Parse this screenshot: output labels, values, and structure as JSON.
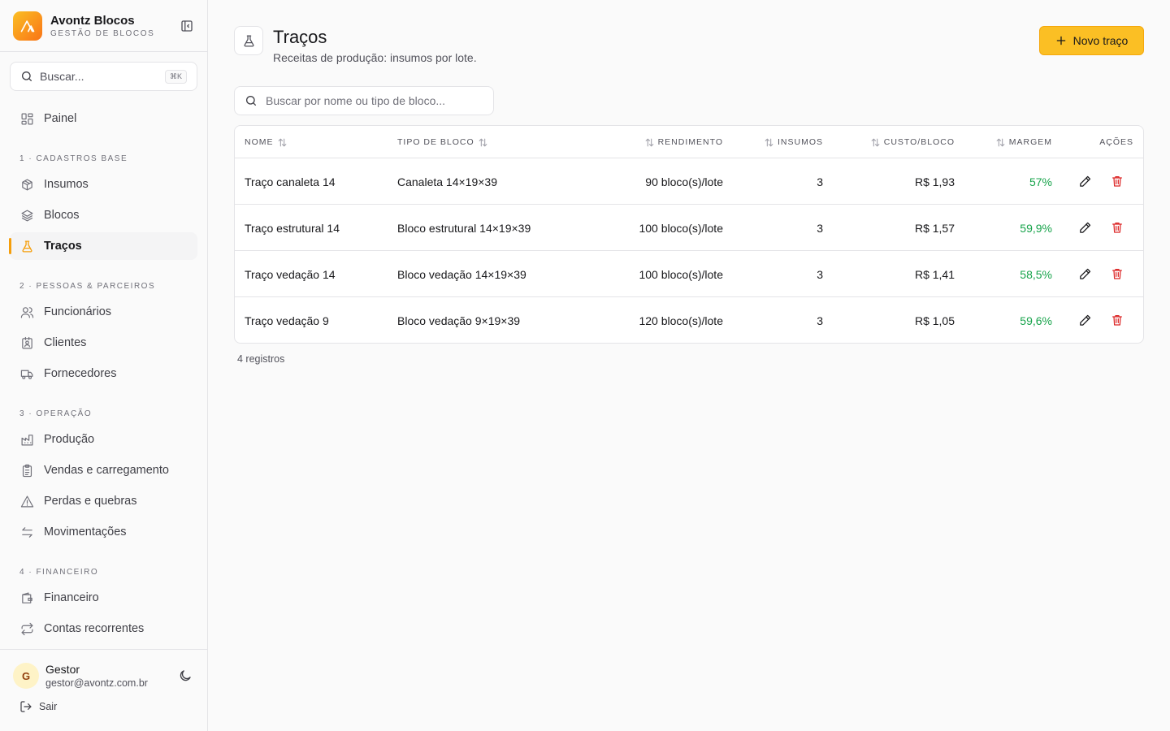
{
  "brand": {
    "name": "Avontz Blocos",
    "subtitle": "GESTÃO DE BLOCOS"
  },
  "sidebar": {
    "search_placeholder": "Buscar...",
    "search_shortcut": "⌘K",
    "home": {
      "label": "Painel",
      "icon": "dashboard-icon"
    },
    "sections": [
      {
        "label": "1 · CADASTROS BASE",
        "items": [
          {
            "label": "Insumos",
            "icon": "package-icon"
          },
          {
            "label": "Blocos",
            "icon": "layers-icon"
          },
          {
            "label": "Traços",
            "icon": "flask-icon",
            "active": true
          }
        ]
      },
      {
        "label": "2 · PESSOAS & PARCEIROS",
        "items": [
          {
            "label": "Funcionários",
            "icon": "users-icon"
          },
          {
            "label": "Clientes",
            "icon": "contact-icon"
          },
          {
            "label": "Fornecedores",
            "icon": "truck-icon"
          }
        ]
      },
      {
        "label": "3 · OPERAÇÃO",
        "items": [
          {
            "label": "Produção",
            "icon": "factory-icon"
          },
          {
            "label": "Vendas e carregamento",
            "icon": "clipboard-icon"
          },
          {
            "label": "Perdas e quebras",
            "icon": "warning-icon"
          },
          {
            "label": "Movimentações",
            "icon": "arrows-icon"
          }
        ]
      },
      {
        "label": "4 · FINANCEIRO",
        "items": [
          {
            "label": "Financeiro",
            "icon": "wallet-icon"
          },
          {
            "label": "Contas recorrentes",
            "icon": "repeat-icon"
          }
        ]
      }
    ],
    "user": {
      "initial": "G",
      "name": "Gestor",
      "email": "gestor@avontz.com.br"
    },
    "logout_label": "Sair"
  },
  "page": {
    "title": "Traços",
    "subtitle": "Receitas de produção: insumos por lote.",
    "new_button_label": "Novo traço",
    "search_placeholder": "Buscar por nome ou tipo de bloco..."
  },
  "table": {
    "columns": [
      "NOME",
      "TIPO DE BLOCO",
      "RENDIMENTO",
      "INSUMOS",
      "CUSTO/BLOCO",
      "MARGEM",
      "AÇÕES"
    ],
    "rows": [
      {
        "nome": "Traço canaleta 14",
        "tipo": "Canaleta 14×19×39",
        "rendimento": "90 bloco(s)/lote",
        "insumos": "3",
        "custo": "R$ 1,93",
        "margem": "57%"
      },
      {
        "nome": "Traço estrutural 14",
        "tipo": "Bloco estrutural 14×19×39",
        "rendimento": "100 bloco(s)/lote",
        "insumos": "3",
        "custo": "R$ 1,57",
        "margem": "59,9%"
      },
      {
        "nome": "Traço vedação 14",
        "tipo": "Bloco vedação 14×19×39",
        "rendimento": "100 bloco(s)/lote",
        "insumos": "3",
        "custo": "R$ 1,41",
        "margem": "58,5%"
      },
      {
        "nome": "Traço vedação 9",
        "tipo": "Bloco vedação 9×19×39",
        "rendimento": "120 bloco(s)/lote",
        "insumos": "3",
        "custo": "R$ 1,05",
        "margem": "59,6%"
      }
    ],
    "footer": "4 registros"
  },
  "colors": {
    "accent": "#fbbf24",
    "positive": "#16a34a",
    "danger": "#dc2626"
  }
}
